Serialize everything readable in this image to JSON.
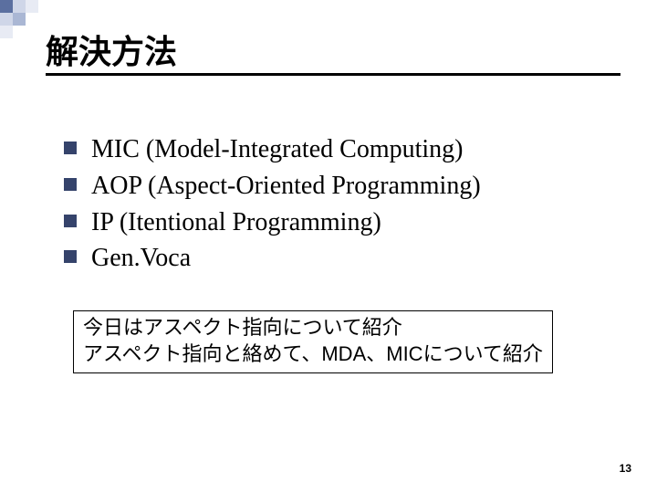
{
  "title": "解決方法",
  "bullets": [
    "MIC (Model-Integrated Computing)",
    "AOP (Aspect-Oriented Programming)",
    "IP (Itentional Programming)",
    "Gen.Voca"
  ],
  "note": {
    "line1": "今日はアスペクト指向について紹介",
    "line2": "アスペクト指向と絡めて、MDA、MICについて紹介"
  },
  "page_number": "13"
}
